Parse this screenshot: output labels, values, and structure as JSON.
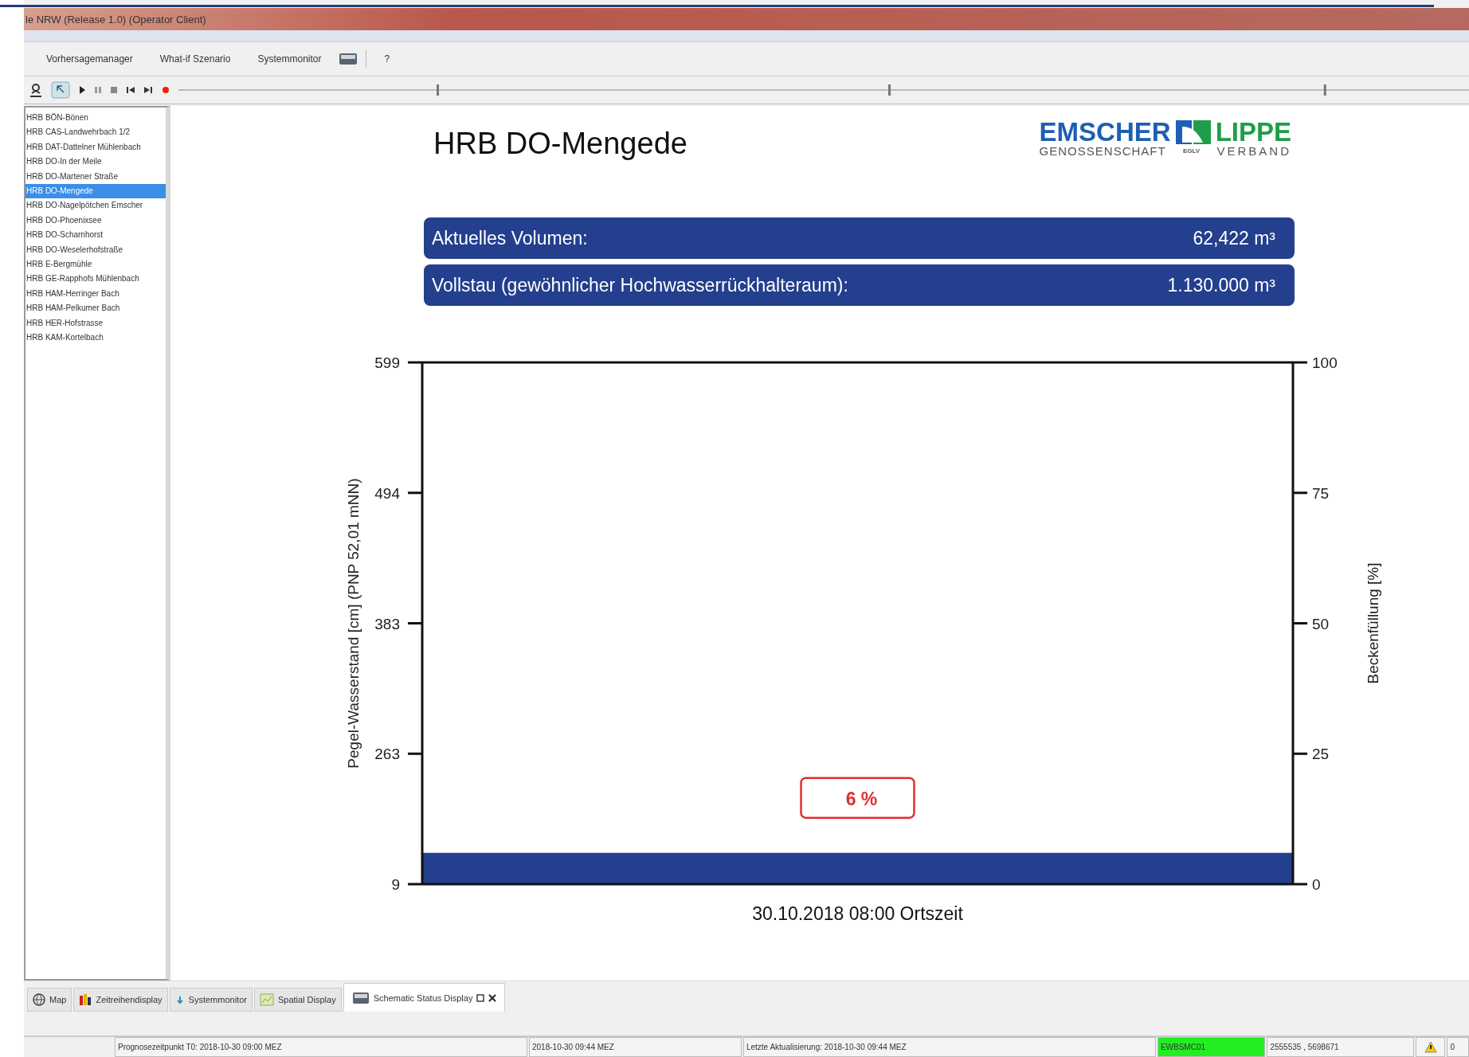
{
  "window": {
    "title": "le NRW (Release 1.0) (Operator Client)"
  },
  "menu": [
    "Vorhersagemanager",
    "What-if Szenario",
    "Systemmonitor",
    "?"
  ],
  "sidebar": {
    "items": [
      {
        "label": "HRB BÖN-Bönen",
        "selected": false
      },
      {
        "label": "HRB CAS-Landwehrbach 1/2",
        "selected": false
      },
      {
        "label": "HRB DAT-Dattelner Mühlenbach",
        "selected": false
      },
      {
        "label": "HRB DO-In der Meile",
        "selected": false
      },
      {
        "label": "HRB DO-Martener Straße",
        "selected": false
      },
      {
        "label": "HRB DO-Mengede",
        "selected": true
      },
      {
        "label": "HRB DO-Nagelpötchen Emscher",
        "selected": false
      },
      {
        "label": "HRB DO-Phoenixsee",
        "selected": false
      },
      {
        "label": "HRB DO-Scharnhorst",
        "selected": false
      },
      {
        "label": "HRB DO-Weselerhofstraße",
        "selected": false
      },
      {
        "label": "HRB E-Bergmühle",
        "selected": false
      },
      {
        "label": "HRB GE-Rapphofs Mühlenbach",
        "selected": false
      },
      {
        "label": "HRB HAM-Herringer Bach",
        "selected": false
      },
      {
        "label": "HRB HAM-Pelkumer Bach",
        "selected": false
      },
      {
        "label": "HRB HER-Hofstrasse",
        "selected": false
      },
      {
        "label": "HRB KAM-Kortelbach",
        "selected": false
      }
    ]
  },
  "display": {
    "title": "HRB DO-Mengede",
    "logo": {
      "top_left": "EMSCHER",
      "top_right": "LIPPE",
      "bottom_left": "GENOSSENSCHAFT",
      "middle": "EGLV",
      "bottom_right": "VERBAND"
    },
    "info_rows": [
      {
        "label": "Aktuelles Volumen:",
        "value": "62,422 m³"
      },
      {
        "label": "Vollstau (gewöhnlicher Hochwasserrückhalteraum):",
        "value": "1.130.000 m³"
      }
    ],
    "level_axis": {
      "label": "Pegel-Wasserstand [cm] (PNP 52,01 mNN)",
      "tick_labels": [
        "599",
        "494",
        "383",
        "263",
        "9"
      ]
    },
    "chart_data": {
      "type": "bar",
      "xlabel": "30.10.2018 08:00 Ortszeit",
      "ylabel": "Beckenfüllung [%]",
      "values": [
        6
      ],
      "ylim": [
        0,
        100
      ],
      "yticks": [
        0,
        25,
        50,
        75,
        100
      ],
      "value_labels": [
        "6 %"
      ]
    }
  },
  "bottom_tabs": [
    {
      "label": "Map",
      "selected": false
    },
    {
      "label": "Zeitreihendisplay",
      "selected": false
    },
    {
      "label": "Systemmonitor",
      "selected": false
    },
    {
      "label": "Spatial Display",
      "selected": false
    },
    {
      "label": "Schematic Status Display",
      "selected": true
    }
  ],
  "status_bar": {
    "forecast_time": "Prognosezeitpunkt T0: 2018-10-30 09:00 MEZ",
    "system_time": "2018-10-30 09:44 MEZ",
    "last_update": "Letzte Aktualisierung: 2018-10-30 09:44 MEZ",
    "server": "EWBSMC01",
    "coordinates": "2555535 , 5698671",
    "cut_field": "0"
  }
}
